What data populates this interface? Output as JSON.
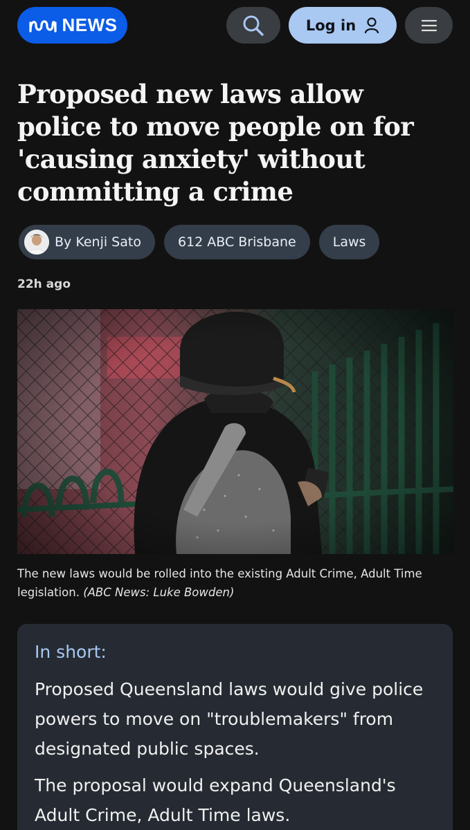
{
  "header": {
    "logo_text": "NEWS",
    "login_label": "Log in",
    "search_icon": "search-icon",
    "menu_icon": "hamburger-menu-icon",
    "user_icon": "user-icon"
  },
  "article": {
    "headline": "Proposed new laws allow police to move people on for 'causing anxiety' without committing a crime",
    "tags": {
      "author": "By Kenji Sato",
      "station": "612 ABC Brisbane",
      "topic": "Laws"
    },
    "timestamp": "22h ago",
    "caption": "The new laws would be rolled into the existing Adult Crime, Adult Time legislation.",
    "credit": "(ABC News: Luke Bowden)"
  },
  "in_short": {
    "title": "In short:",
    "paragraphs": [
      "Proposed Queensland laws would give police powers to move on \"troublemakers\" from designated public spaces.",
      "The proposal would expand Queensland's Adult Crime, Adult Time laws."
    ]
  },
  "colors": {
    "background": "#121212",
    "brand_blue": "#0b5ce6",
    "login_bg": "#a9c8f2",
    "tag_bg": "#343e4a",
    "panel_bg": "#262b33"
  }
}
